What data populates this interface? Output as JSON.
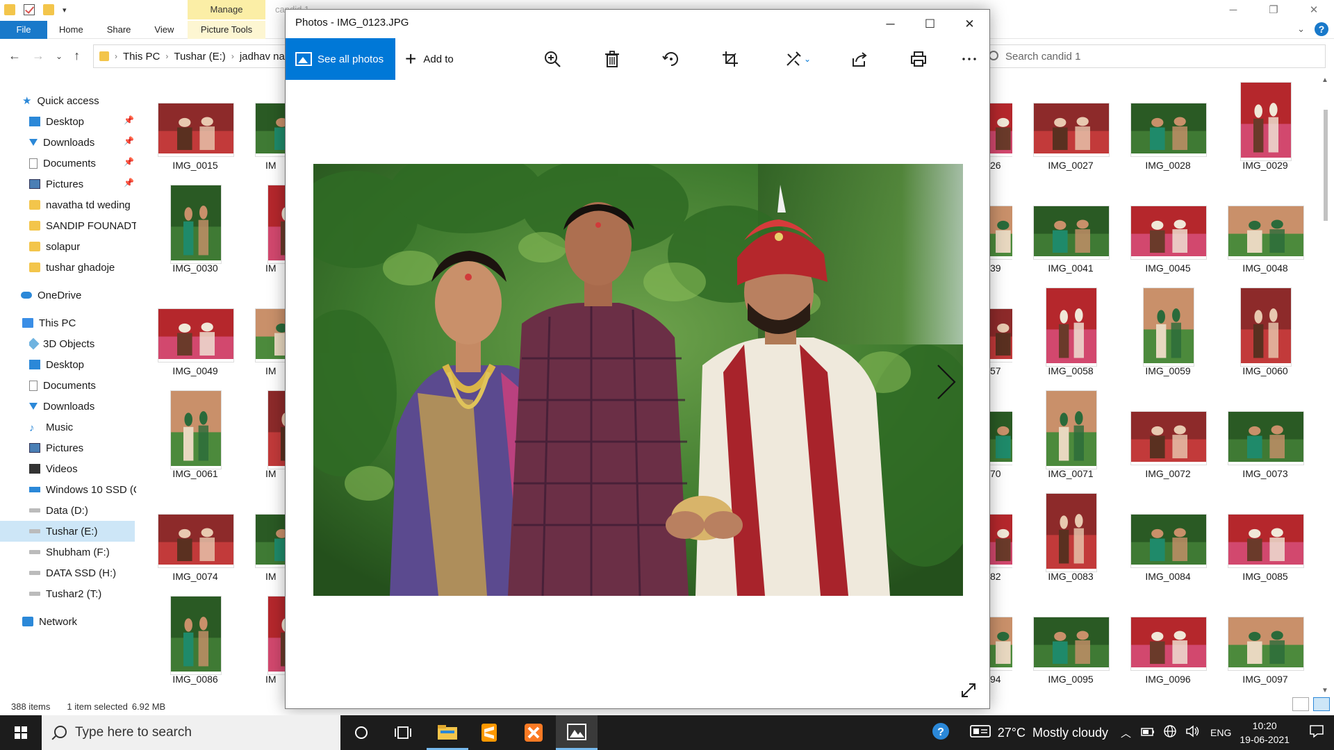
{
  "explorer": {
    "title_ghost": "candid 1",
    "ribbon": {
      "contextual_group": "Manage",
      "tabs": [
        "File",
        "Home",
        "Share",
        "View"
      ],
      "contextual_tab": "Picture Tools"
    },
    "breadcrumb": [
      "This PC",
      "Tushar (E:)",
      "jadhav na"
    ],
    "search_placeholder": "Search candid 1",
    "nav": {
      "quick_access": "Quick access",
      "quick_items": [
        "Desktop",
        "Downloads",
        "Documents",
        "Pictures",
        "navatha td weding",
        "SANDIP FOUNADTI(",
        "solapur",
        "tushar ghadoje"
      ],
      "onedrive": "OneDrive",
      "this_pc": "This PC",
      "pc_items": [
        "3D Objects",
        "Desktop",
        "Documents",
        "Downloads",
        "Music",
        "Pictures",
        "Videos",
        "Windows 10 SSD (C",
        "Data (D:)",
        "Tushar (E:)",
        "Shubham (F:)",
        "DATA SSD (H:)",
        "Tushar2 (T:)"
      ],
      "network": "Network"
    },
    "left_thumbs": [
      [
        "IMG_0015",
        "IM"
      ],
      [
        "IMG_0030",
        "IM"
      ],
      [
        "IMG_0049",
        "IM"
      ],
      [
        "IMG_0061",
        "IM"
      ],
      [
        "IMG_0074",
        "IM"
      ],
      [
        "IMG_0086",
        "IM"
      ]
    ],
    "right_partial": [
      "26",
      "39",
      "57",
      "70",
      "82",
      "94"
    ],
    "right_thumbs": [
      [
        "IMG_0027",
        "IMG_0028",
        "IMG_0029"
      ],
      [
        "IMG_0041",
        "IMG_0045",
        "IMG_0048"
      ],
      [
        "IMG_0058",
        "IMG_0059",
        "IMG_0060"
      ],
      [
        "IMG_0071",
        "IMG_0072",
        "IMG_0073"
      ],
      [
        "IMG_0083",
        "IMG_0084",
        "IMG_0085"
      ],
      [
        "IMG_0095",
        "IMG_0096",
        "IMG_0097"
      ]
    ],
    "status": {
      "items": "388 items",
      "selected": "1 item selected",
      "size": "6.92 MB"
    }
  },
  "photos": {
    "title": "Photos - IMG_0123.JPG",
    "see_all": "See all photos",
    "add_to": "Add to"
  },
  "taskbar": {
    "search_placeholder": "Type here to search",
    "weather": "27°C  Mostly cloudy",
    "lang": "ENG",
    "time": "10:20",
    "date": "19-06-2021"
  }
}
